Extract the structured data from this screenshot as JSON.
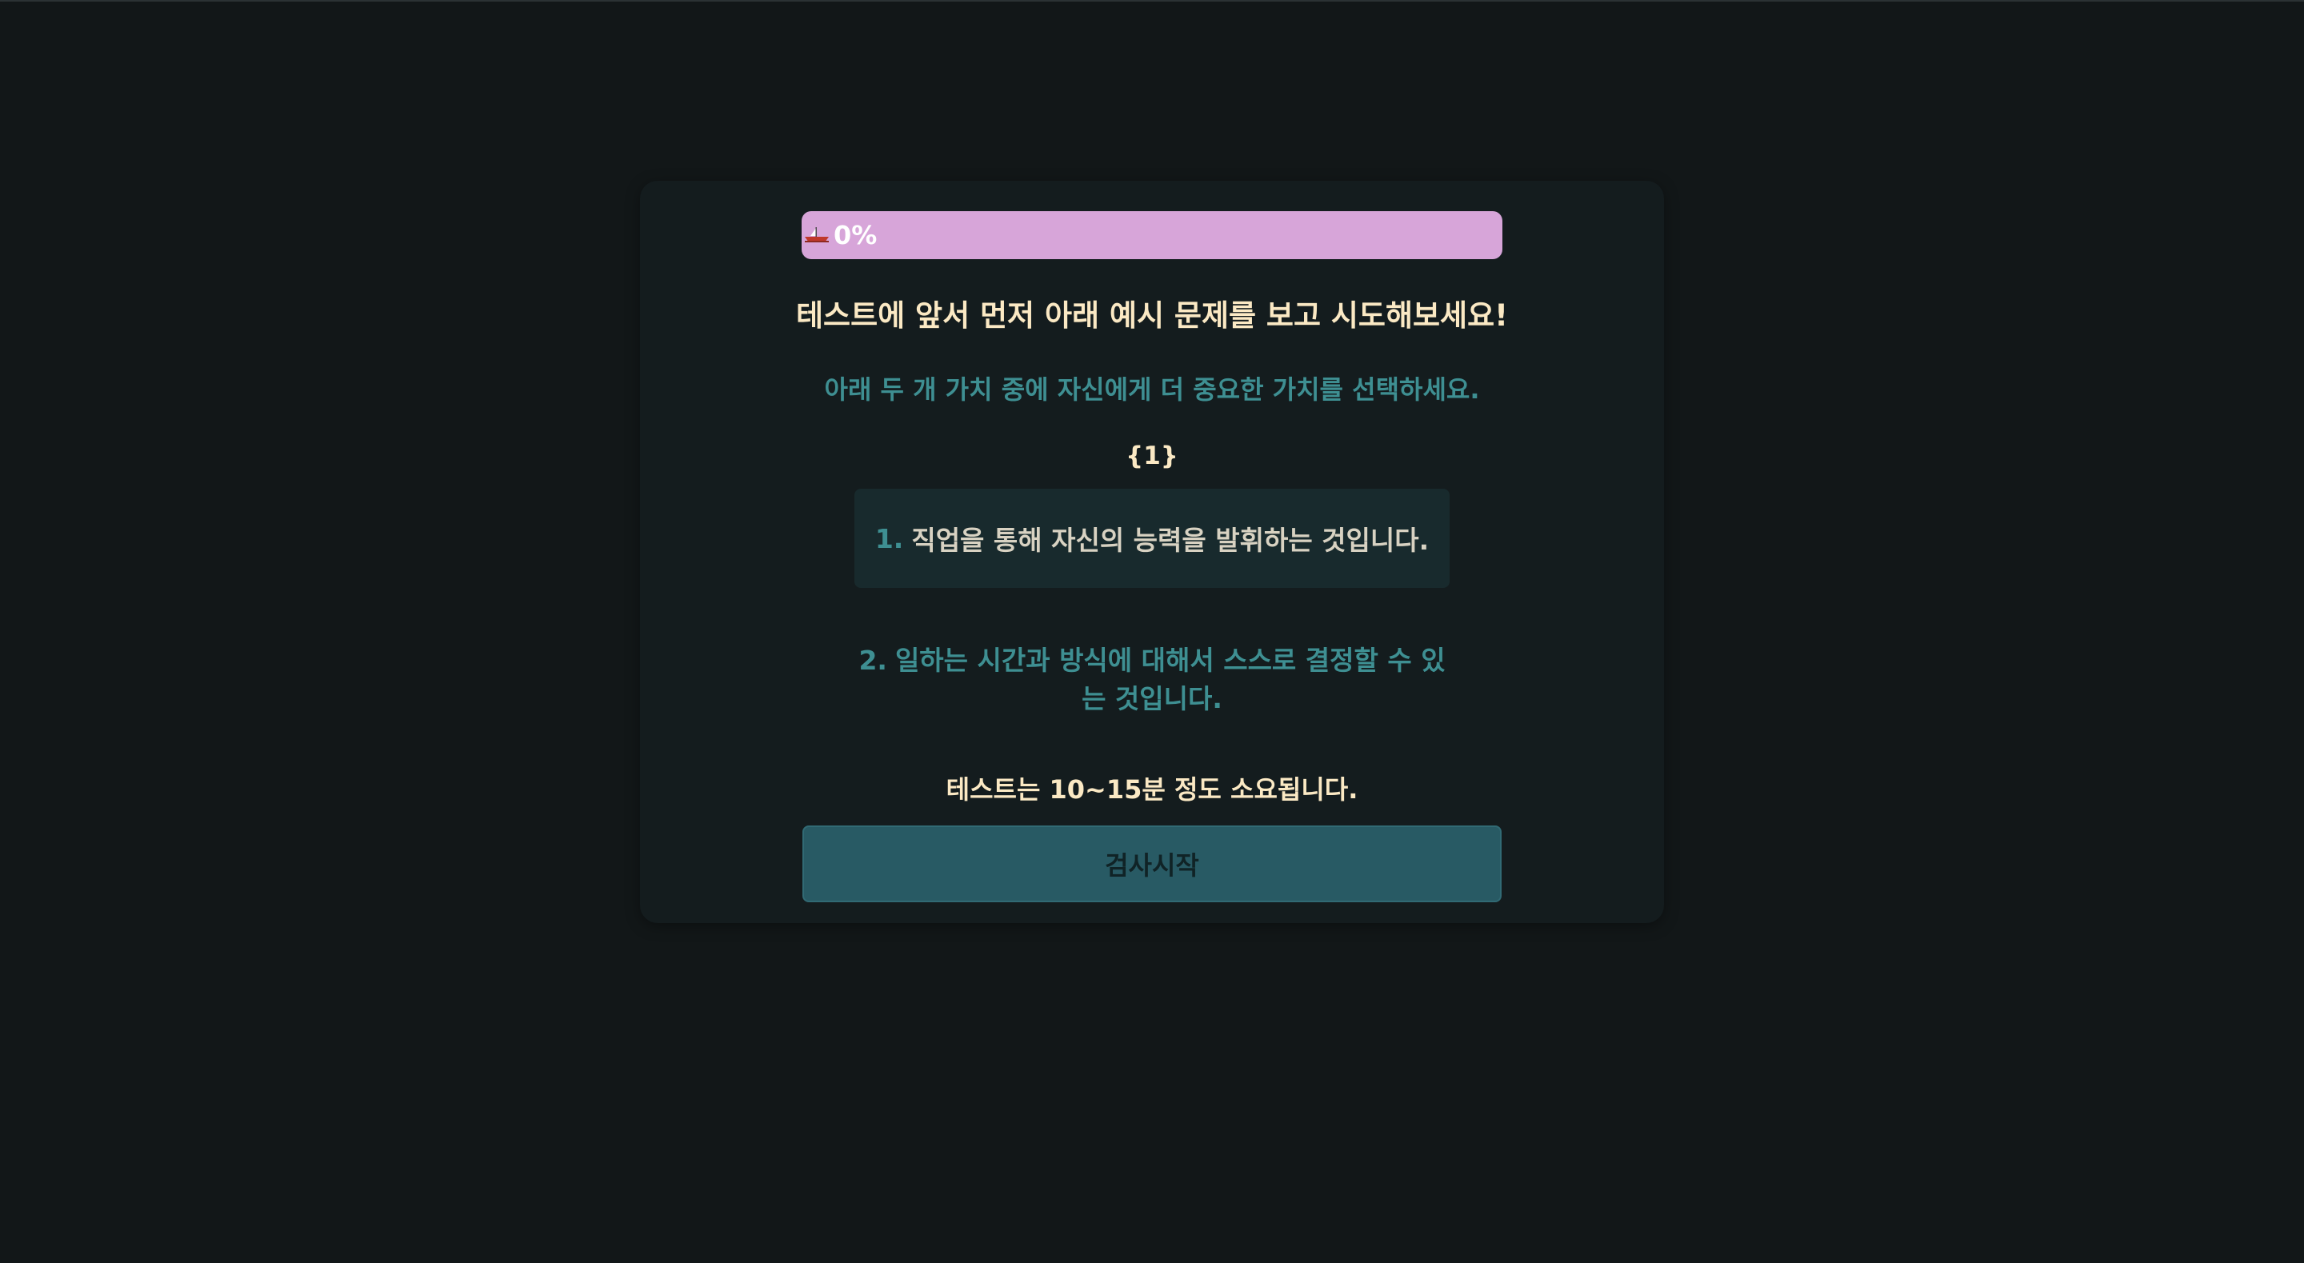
{
  "progress": {
    "label": "0%",
    "percent": 0,
    "bar_color": "#d7a5d9",
    "icon": "boat-icon"
  },
  "intro": {
    "title": "테스트에 앞서 먼저 아래 예시 문제를 보고 시도해보세요!",
    "instruction": "아래 두 개 가치 중에 자신에게 더 중요한 가치를 선택하세요.",
    "counter": "{1}"
  },
  "options": [
    {
      "number": "1.",
      "text": "직업을 통해 자신의 능력을 발휘하는 것입니다."
    },
    {
      "number": "2.",
      "text": "일하는 시간과 방식에 대해서 스스로 결정할 수 있는 것입니다."
    }
  ],
  "footer": {
    "duration_note": "테스트는 10~15분 정도 소요됩니다.",
    "start_label": "검사시작"
  },
  "colors": {
    "background": "#121718",
    "card": "#141c1e",
    "accent_teal": "#3e8f92",
    "heading_cream": "#fbe9c4",
    "button": "#285a64"
  }
}
